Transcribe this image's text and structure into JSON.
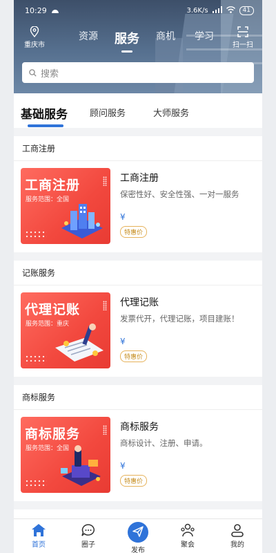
{
  "status_bar": {
    "time": "10:29",
    "network": "3.6K/s",
    "battery": "41"
  },
  "header": {
    "location": "重庆市",
    "scan_label": "扫一扫",
    "tabs": [
      {
        "label": "资源",
        "active": false
      },
      {
        "label": "服务",
        "active": true
      },
      {
        "label": "商机",
        "active": false
      },
      {
        "label": "学习",
        "active": false
      }
    ],
    "search_placeholder": "搜索"
  },
  "subtabs": [
    {
      "label": "基础服务",
      "active": true
    },
    {
      "label": "顾问服务",
      "active": false
    },
    {
      "label": "大师服务",
      "active": false
    }
  ],
  "sections": [
    {
      "title": "工商注册",
      "card": {
        "image_title": "工商注册",
        "image_scope": "服务范围：全国",
        "name": "工商注册",
        "desc": "保密性好、安全性强、一对一服务",
        "price_symbol": "¥",
        "tag": "特惠价"
      }
    },
    {
      "title": "记账服务",
      "card": {
        "image_title": "代理记账",
        "image_scope": "服务范围：重庆",
        "name": "代理记账",
        "desc": "发票代开，代理记账，项目建账！",
        "price_symbol": "¥",
        "tag": "特惠价"
      }
    },
    {
      "title": "商标服务",
      "card": {
        "image_title": "商标服务",
        "image_scope": "服务范围：全国",
        "name": "商标服务",
        "desc": "商标设计、注册、申请。",
        "price_symbol": "¥",
        "tag": "特惠价"
      }
    }
  ],
  "bottom_nav": [
    {
      "label": "首页",
      "icon": "home-icon",
      "active": true
    },
    {
      "label": "圈子",
      "icon": "chat-icon",
      "active": false
    },
    {
      "label": "发布",
      "icon": "send-icon",
      "active": false
    },
    {
      "label": "聚会",
      "icon": "group-icon",
      "active": false
    },
    {
      "label": "我的",
      "icon": "user-icon",
      "active": false
    }
  ],
  "colors": {
    "accent": "#2f73d9",
    "card_red": "#f2483e",
    "tag_gold": "#c58b1c"
  }
}
